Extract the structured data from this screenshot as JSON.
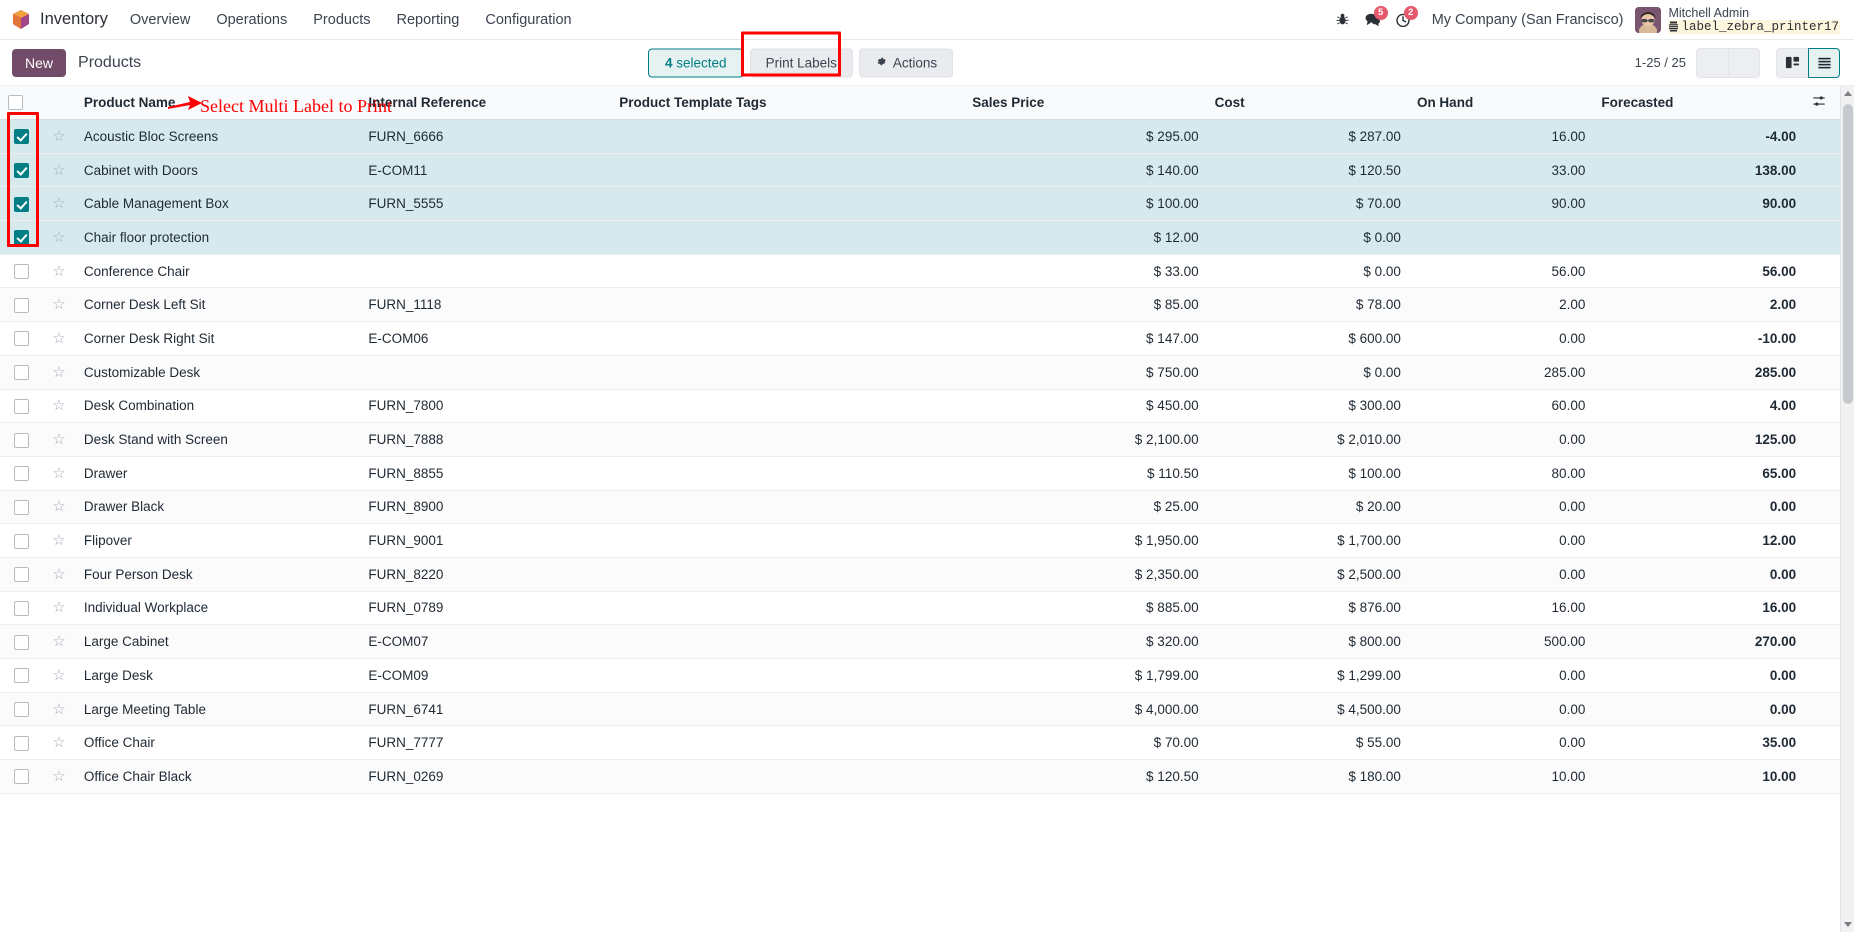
{
  "navbar": {
    "app_name": "Inventory",
    "logo_icon": "odoo-cube-icon",
    "menu": [
      {
        "label": "Overview"
      },
      {
        "label": "Operations"
      },
      {
        "label": "Products"
      },
      {
        "label": "Reporting"
      },
      {
        "label": "Configuration"
      }
    ],
    "bug_icon": "bug-icon",
    "messages": {
      "icon": "chat-bubble-icon",
      "count": "5"
    },
    "activities": {
      "icon": "clock-icon",
      "count": "2"
    },
    "company": "My Company (San Francisco)",
    "avatar_icon": "user-avatar",
    "user_name": "Mitchell Admin",
    "printer_icon": "printer-icon",
    "printer_name": "label_zebra_printer17"
  },
  "control_panel": {
    "new_label": "New",
    "breadcrumb": "Products",
    "selected_count": "4",
    "selected_label": "selected",
    "print_labels_label": "Print Labels",
    "actions_label": "Actions",
    "actions_icon": "gear-icon",
    "pager": "1-25 / 25",
    "prev_icon": "chevron-left-icon",
    "next_icon": "chevron-right-icon",
    "kanban_view_icon": "kanban-view-icon",
    "list_view_icon": "list-view-icon",
    "active_view": "list"
  },
  "annotation": {
    "text": "Select Multi Label to Print",
    "color": "#ff0000",
    "arrow_icon": "arrow-right-icon"
  },
  "table": {
    "columns": [
      {
        "key": "name",
        "label": "Product Name"
      },
      {
        "key": "ref",
        "label": "Internal Reference"
      },
      {
        "key": "tags",
        "label": "Product Template Tags"
      },
      {
        "key": "price",
        "label": "Sales Price"
      },
      {
        "key": "cost",
        "label": "Cost"
      },
      {
        "key": "hand",
        "label": "On Hand"
      },
      {
        "key": "fore",
        "label": "Forecasted"
      }
    ],
    "optional_columns_icon": "column-options-icon",
    "star_icon": "star-outline-icon",
    "rows": [
      {
        "selected": true,
        "name": "Acoustic Bloc Screens",
        "ref": "FURN_6666",
        "tags": "",
        "price": "$ 295.00",
        "cost": "$ 287.00",
        "hand": "16.00",
        "fore": "-4.00",
        "fore_negative": true
      },
      {
        "selected": true,
        "name": "Cabinet with Doors",
        "ref": "E-COM11",
        "tags": "",
        "price": "$ 140.00",
        "cost": "$ 120.50",
        "hand": "33.00",
        "fore": "138.00",
        "fore_negative": false
      },
      {
        "selected": true,
        "name": "Cable Management Box",
        "ref": "FURN_5555",
        "tags": "",
        "price": "$ 100.00",
        "cost": "$ 70.00",
        "hand": "90.00",
        "fore": "90.00",
        "fore_negative": false
      },
      {
        "selected": true,
        "name": "Chair floor protection",
        "ref": "",
        "tags": "",
        "price": "$ 12.00",
        "cost": "$ 0.00",
        "hand": "",
        "fore": "",
        "fore_negative": false
      },
      {
        "selected": false,
        "name": "Conference Chair",
        "ref": "",
        "tags": "",
        "price": "$ 33.00",
        "cost": "$ 0.00",
        "hand": "56.00",
        "fore": "56.00",
        "fore_negative": false
      },
      {
        "selected": false,
        "name": "Corner Desk Left Sit",
        "ref": "FURN_1118",
        "tags": "",
        "price": "$ 85.00",
        "cost": "$ 78.00",
        "hand": "2.00",
        "fore": "2.00",
        "fore_negative": false
      },
      {
        "selected": false,
        "name": "Corner Desk Right Sit",
        "ref": "E-COM06",
        "tags": "",
        "price": "$ 147.00",
        "cost": "$ 600.00",
        "hand": "0.00",
        "fore": "-10.00",
        "fore_negative": true
      },
      {
        "selected": false,
        "name": "Customizable Desk",
        "ref": "",
        "tags": "",
        "price": "$ 750.00",
        "cost": "$ 0.00",
        "hand": "285.00",
        "fore": "285.00",
        "fore_negative": false
      },
      {
        "selected": false,
        "name": "Desk Combination",
        "ref": "FURN_7800",
        "tags": "",
        "price": "$ 450.00",
        "cost": "$ 300.00",
        "hand": "60.00",
        "fore": "4.00",
        "fore_negative": false
      },
      {
        "selected": false,
        "name": "Desk Stand with Screen",
        "ref": "FURN_7888",
        "tags": "",
        "price": "$ 2,100.00",
        "cost": "$ 2,010.00",
        "hand": "0.00",
        "fore": "125.00",
        "fore_negative": false
      },
      {
        "selected": false,
        "name": "Drawer",
        "ref": "FURN_8855",
        "tags": "",
        "price": "$ 110.50",
        "cost": "$ 100.00",
        "hand": "80.00",
        "fore": "65.00",
        "fore_negative": false
      },
      {
        "selected": false,
        "name": "Drawer Black",
        "ref": "FURN_8900",
        "tags": "",
        "price": "$ 25.00",
        "cost": "$ 20.00",
        "hand": "0.00",
        "fore": "0.00",
        "fore_negative": false
      },
      {
        "selected": false,
        "name": "Flipover",
        "ref": "FURN_9001",
        "tags": "",
        "price": "$ 1,950.00",
        "cost": "$ 1,700.00",
        "hand": "0.00",
        "fore": "12.00",
        "fore_negative": false
      },
      {
        "selected": false,
        "name": "Four Person Desk",
        "ref": "FURN_8220",
        "tags": "",
        "price": "$ 2,350.00",
        "cost": "$ 2,500.00",
        "hand": "0.00",
        "fore": "0.00",
        "fore_negative": false
      },
      {
        "selected": false,
        "name": "Individual Workplace",
        "ref": "FURN_0789",
        "tags": "",
        "price": "$ 885.00",
        "cost": "$ 876.00",
        "hand": "16.00",
        "fore": "16.00",
        "fore_negative": false
      },
      {
        "selected": false,
        "name": "Large Cabinet",
        "ref": "E-COM07",
        "tags": "",
        "price": "$ 320.00",
        "cost": "$ 800.00",
        "hand": "500.00",
        "fore": "270.00",
        "fore_negative": false
      },
      {
        "selected": false,
        "name": "Large Desk",
        "ref": "E-COM09",
        "tags": "",
        "price": "$ 1,799.00",
        "cost": "$ 1,299.00",
        "hand": "0.00",
        "fore": "0.00",
        "fore_negative": false
      },
      {
        "selected": false,
        "name": "Large Meeting Table",
        "ref": "FURN_6741",
        "tags": "",
        "price": "$ 4,000.00",
        "cost": "$ 4,500.00",
        "hand": "0.00",
        "fore": "0.00",
        "fore_negative": false
      },
      {
        "selected": false,
        "name": "Office Chair",
        "ref": "FURN_7777",
        "tags": "",
        "price": "$ 70.00",
        "cost": "$ 55.00",
        "hand": "0.00",
        "fore": "35.00",
        "fore_negative": false
      },
      {
        "selected": false,
        "name": "Office Chair Black",
        "ref": "FURN_0269",
        "tags": "",
        "price": "$ 120.50",
        "cost": "$ 180.00",
        "hand": "10.00",
        "fore": "10.00",
        "fore_negative": false
      }
    ]
  },
  "colors": {
    "accent": "#714b67",
    "selection": "#017e84",
    "selected_row_bg": "#d6eaee",
    "negative": "#e8201f",
    "annotation": "#ff0000"
  }
}
